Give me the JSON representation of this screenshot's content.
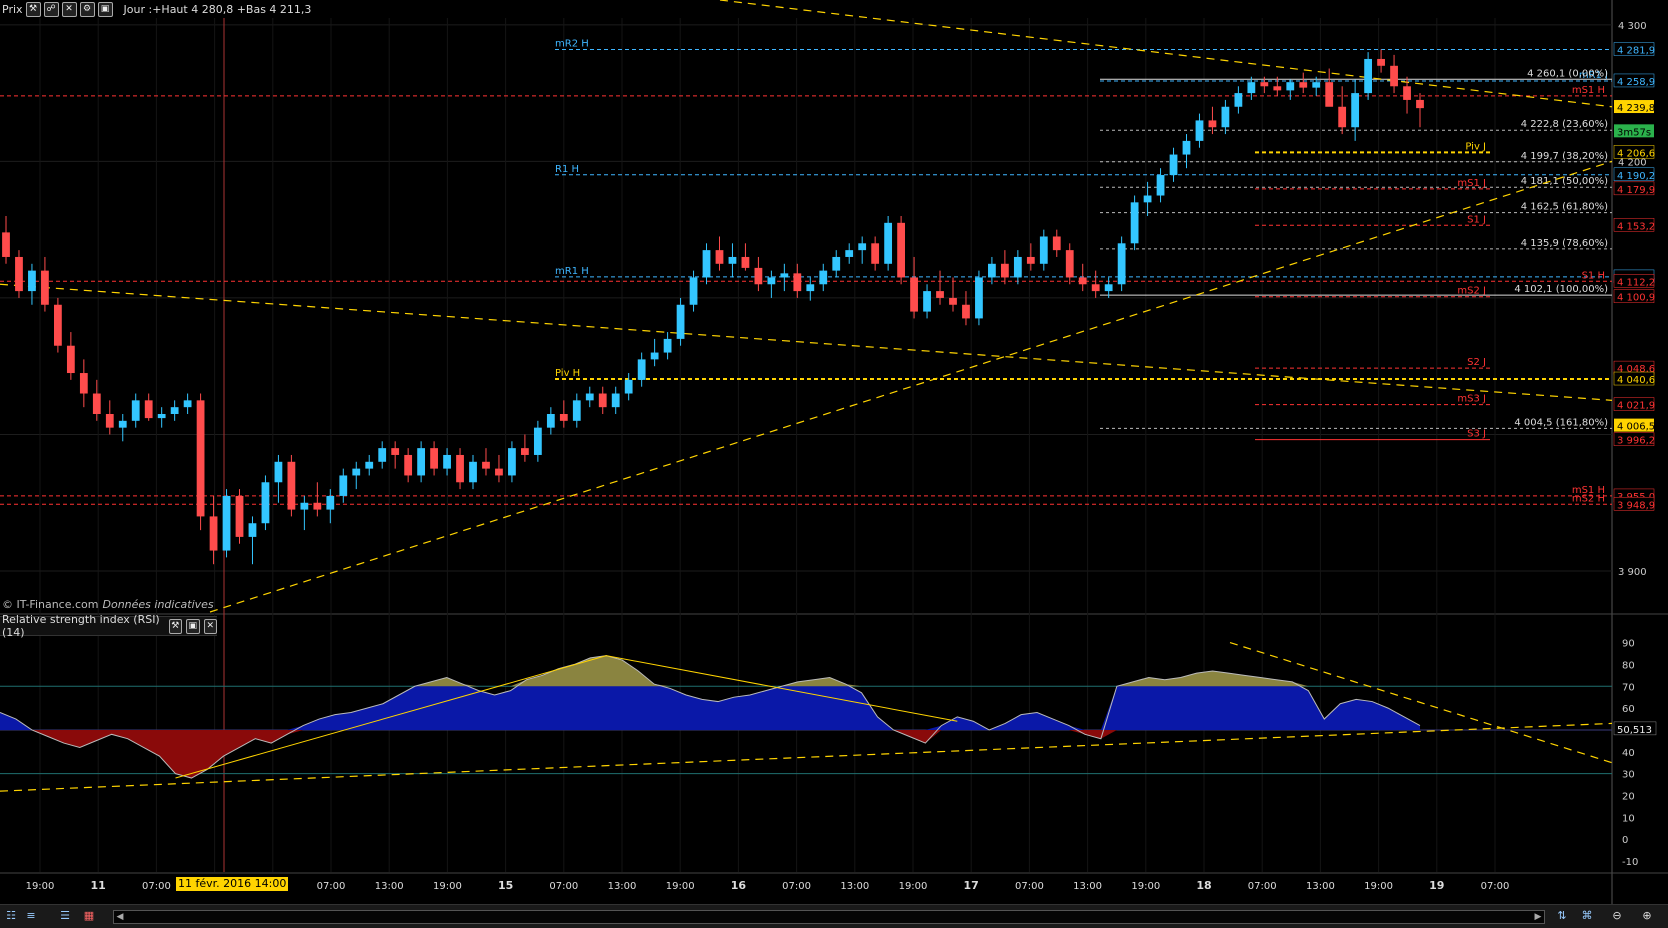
{
  "toolbar": {
    "label": "Prix",
    "info": "Jour :+Haut 4 280,8 +Bas 4 211,3",
    "icons": [
      "wrench-icon",
      "link-icon",
      "close-icon",
      "settings-icon",
      "window-icon"
    ]
  },
  "watermark": {
    "source": "© IT-Finance.com",
    "note": "Données indicatives"
  },
  "rsi_panel": {
    "title": "Relative strength index (RSI) (14)",
    "current_value": "50,513"
  },
  "price_axis": {
    "ticks": [
      "4 300",
      "4 200",
      "3 900"
    ],
    "tags": [
      {
        "text": "4 281,9",
        "bg": "#000",
        "fg": "#3fb6ff"
      },
      {
        "text": "4 258,9",
        "bg": "#000",
        "fg": "#3fb6ff"
      },
      {
        "text": "4 239,8",
        "bg": "#ffd400",
        "fg": "#000"
      },
      {
        "text": "3m57s",
        "bg": "#2bb24c",
        "fg": "#000"
      },
      {
        "text": "4 206,6",
        "bg": "#000",
        "fg": "#ffd400"
      },
      {
        "text": "4 190,2",
        "bg": "#000",
        "fg": "#3fb6ff"
      },
      {
        "text": "4 179,9",
        "bg": "#000",
        "fg": "#ff3333"
      },
      {
        "text": "4 153,2",
        "bg": "#000",
        "fg": "#ff3333"
      },
      {
        "text": "4 115,4",
        "bg": "#000",
        "fg": "#3fb6ff"
      },
      {
        "text": "4 112,2",
        "bg": "#000",
        "fg": "#ff3333"
      },
      {
        "text": "4 100,9",
        "bg": "#000",
        "fg": "#ff3333"
      },
      {
        "text": "4 048,6",
        "bg": "#000",
        "fg": "#ff3333"
      },
      {
        "text": "4 040,6",
        "bg": "#000",
        "fg": "#ffd400"
      },
      {
        "text": "4 021,9",
        "bg": "#000",
        "fg": "#ff3333"
      },
      {
        "text": "4 006,5",
        "bg": "#ffd400",
        "fg": "#000"
      },
      {
        "text": "3 996,2",
        "bg": "#000",
        "fg": "#ff3333"
      },
      {
        "text": "3 955,0",
        "bg": "#000",
        "fg": "#ff3333"
      },
      {
        "text": "3 948,9",
        "bg": "#000",
        "fg": "#ff3333"
      }
    ]
  },
  "rsi_axis": {
    "ticks": [
      "90",
      "80",
      "70",
      "60",
      "50",
      "40",
      "30",
      "20",
      "10",
      "0",
      "-10"
    ]
  },
  "levels": {
    "pivots": [
      "mR2 H",
      "mR1 J",
      "mS1 H",
      "R1 H",
      "mR1 H",
      "Piv H",
      "mS1 H",
      "Piv J",
      "mS1 J",
      "S1 J",
      "S1 H",
      "mS2 J",
      "S2 J",
      "mS3 J",
      "S3 J",
      "mS2 H"
    ],
    "fib": [
      "4 260,1 (0,00%)",
      "4 222,8 (23,60%)",
      "4 199,7 (38,20%)",
      "4 181,1 (50,00%)",
      "4 162,5 (61,80%)",
      "4 135,9 (78,60%)",
      "4 102,1 (100,00%)",
      "4 004,5 (161,80%)"
    ]
  },
  "time_axis": {
    "labels": [
      "19:00",
      "11",
      "07:00",
      "",
      "12",
      "07:00",
      "13:00",
      "19:00",
      "15",
      "07:00",
      "13:00",
      "19:00",
      "16",
      "07:00",
      "13:00",
      "19:00",
      "17",
      "07:00",
      "13:00",
      "19:00",
      "18",
      "07:00",
      "13:00",
      "19:00",
      "19",
      "07:00"
    ],
    "cursor_label": "11 févr. 2016 14:00"
  },
  "bottom_bar": {
    "icons": [
      "hierarchy-icon",
      "chart-type-icon",
      "list-icon",
      "template-icon",
      "scroll-left-icon",
      "scroll-right-icon",
      "sort-icon",
      "crosshair-icon",
      "zoom-out-icon",
      "zoom-in-icon"
    ]
  },
  "colors": {
    "up": "#33c6ff",
    "down": "#ff4c4c",
    "pivot_yellow": "#ffd400",
    "rsi_blue": "#0a18a8",
    "rsi_red": "#8a0a0a",
    "rsi_olive": "#8a8440"
  },
  "chart_data": {
    "type": "candlestick",
    "ylim": [
      3870,
      4305
    ],
    "rsi_ylim": [
      -15,
      93
    ],
    "candles": [
      [
        4148,
        4160,
        4125,
        4130
      ],
      [
        4130,
        4135,
        4100,
        4105
      ],
      [
        4105,
        4125,
        4095,
        4120
      ],
      [
        4120,
        4130,
        4090,
        4095
      ],
      [
        4095,
        4100,
        4060,
        4065
      ],
      [
        4065,
        4075,
        4040,
        4045
      ],
      [
        4045,
        4055,
        4020,
        4030
      ],
      [
        4030,
        4040,
        4010,
        4015
      ],
      [
        4015,
        4025,
        4000,
        4005
      ],
      [
        4005,
        4015,
        3995,
        4010
      ],
      [
        4010,
        4030,
        4005,
        4025
      ],
      [
        4025,
        4030,
        4010,
        4012
      ],
      [
        4012,
        4020,
        4005,
        4015
      ],
      [
        4015,
        4025,
        4010,
        4020
      ],
      [
        4020,
        4030,
        4015,
        4025
      ],
      [
        4025,
        4030,
        3930,
        3940
      ],
      [
        3940,
        3955,
        3905,
        3915
      ],
      [
        3915,
        3960,
        3910,
        3955
      ],
      [
        3955,
        3960,
        3920,
        3925
      ],
      [
        3925,
        3940,
        3905,
        3935
      ],
      [
        3935,
        3970,
        3930,
        3965
      ],
      [
        3965,
        3985,
        3950,
        3980
      ],
      [
        3980,
        3985,
        3940,
        3945
      ],
      [
        3945,
        3955,
        3930,
        3950
      ],
      [
        3950,
        3965,
        3940,
        3945
      ],
      [
        3945,
        3960,
        3935,
        3955
      ],
      [
        3955,
        3975,
        3950,
        3970
      ],
      [
        3970,
        3980,
        3960,
        3975
      ],
      [
        3975,
        3985,
        3970,
        3980
      ],
      [
        3980,
        3995,
        3975,
        3990
      ],
      [
        3990,
        3995,
        3975,
        3985
      ],
      [
        3985,
        3990,
        3965,
        3970
      ],
      [
        3970,
        3995,
        3965,
        3990
      ],
      [
        3990,
        3995,
        3970,
        3975
      ],
      [
        3975,
        3990,
        3970,
        3985
      ],
      [
        3985,
        3990,
        3960,
        3965
      ],
      [
        3965,
        3985,
        3960,
        3980
      ],
      [
        3980,
        3990,
        3970,
        3975
      ],
      [
        3975,
        3985,
        3965,
        3970
      ],
      [
        3970,
        3995,
        3965,
        3990
      ],
      [
        3990,
        4000,
        3980,
        3985
      ],
      [
        3985,
        4010,
        3980,
        4005
      ],
      [
        4005,
        4020,
        4000,
        4015
      ],
      [
        4015,
        4025,
        4005,
        4010
      ],
      [
        4010,
        4030,
        4005,
        4025
      ],
      [
        4025,
        4035,
        4020,
        4030
      ],
      [
        4030,
        4035,
        4015,
        4020
      ],
      [
        4020,
        4035,
        4015,
        4030
      ],
      [
        4030,
        4045,
        4025,
        4040
      ],
      [
        4040,
        4060,
        4035,
        4055
      ],
      [
        4055,
        4070,
        4050,
        4060
      ],
      [
        4060,
        4075,
        4055,
        4070
      ],
      [
        4070,
        4100,
        4065,
        4095
      ],
      [
        4095,
        4120,
        4090,
        4115
      ],
      [
        4115,
        4140,
        4110,
        4135
      ],
      [
        4135,
        4145,
        4120,
        4125
      ],
      [
        4125,
        4140,
        4115,
        4130
      ],
      [
        4130,
        4140,
        4120,
        4122
      ],
      [
        4122,
        4130,
        4105,
        4110
      ],
      [
        4110,
        4120,
        4100,
        4115
      ],
      [
        4115,
        4125,
        4105,
        4118
      ],
      [
        4118,
        4125,
        4100,
        4105
      ],
      [
        4105,
        4115,
        4098,
        4110
      ],
      [
        4110,
        4125,
        4105,
        4120
      ],
      [
        4120,
        4135,
        4115,
        4130
      ],
      [
        4130,
        4140,
        4125,
        4135
      ],
      [
        4135,
        4145,
        4125,
        4140
      ],
      [
        4140,
        4145,
        4120,
        4125
      ],
      [
        4125,
        4160,
        4120,
        4155
      ],
      [
        4155,
        4160,
        4110,
        4115
      ],
      [
        4115,
        4130,
        4085,
        4090
      ],
      [
        4090,
        4110,
        4085,
        4105
      ],
      [
        4105,
        4120,
        4095,
        4100
      ],
      [
        4100,
        4115,
        4090,
        4095
      ],
      [
        4095,
        4105,
        4080,
        4085
      ],
      [
        4085,
        4120,
        4080,
        4115
      ],
      [
        4115,
        4130,
        4110,
        4125
      ],
      [
        4125,
        4135,
        4110,
        4115
      ],
      [
        4115,
        4135,
        4110,
        4130
      ],
      [
        4130,
        4140,
        4120,
        4125
      ],
      [
        4125,
        4150,
        4120,
        4145
      ],
      [
        4145,
        4150,
        4130,
        4135
      ],
      [
        4135,
        4140,
        4110,
        4115
      ],
      [
        4115,
        4125,
        4105,
        4110
      ],
      [
        4110,
        4120,
        4100,
        4105
      ],
      [
        4105,
        4115,
        4100,
        4110
      ],
      [
        4110,
        4145,
        4105,
        4140
      ],
      [
        4140,
        4175,
        4135,
        4170
      ],
      [
        4170,
        4185,
        4160,
        4175
      ],
      [
        4175,
        4195,
        4170,
        4190
      ],
      [
        4190,
        4210,
        4185,
        4205
      ],
      [
        4205,
        4220,
        4195,
        4215
      ],
      [
        4215,
        4235,
        4210,
        4230
      ],
      [
        4230,
        4240,
        4220,
        4225
      ],
      [
        4225,
        4245,
        4220,
        4240
      ],
      [
        4240,
        4255,
        4235,
        4250
      ],
      [
        4250,
        4262,
        4245,
        4258
      ],
      [
        4258,
        4262,
        4250,
        4255
      ],
      [
        4255,
        4262,
        4248,
        4252
      ],
      [
        4252,
        4260,
        4245,
        4258
      ],
      [
        4258,
        4265,
        4250,
        4254
      ],
      [
        4254,
        4262,
        4248,
        4258
      ],
      [
        4258,
        4268,
        4245,
        4240
      ],
      [
        4240,
        4255,
        4220,
        4225
      ],
      [
        4225,
        4260,
        4215,
        4250
      ],
      [
        4250,
        4280,
        4245,
        4275
      ],
      [
        4275,
        4282,
        4265,
        4270
      ],
      [
        4270,
        4278,
        4250,
        4255
      ],
      [
        4255,
        4262,
        4235,
        4245
      ],
      [
        4245,
        4250,
        4225,
        4239
      ]
    ],
    "rsi_values": [
      58,
      55,
      50,
      47,
      44,
      42,
      45,
      48,
      46,
      42,
      38,
      30,
      28,
      32,
      38,
      42,
      46,
      44,
      48,
      52,
      55,
      57,
      58,
      60,
      62,
      66,
      70,
      72,
      74,
      71,
      68,
      66,
      68,
      73,
      75,
      78,
      80,
      83,
      84,
      82,
      77,
      71,
      69,
      66,
      64,
      63,
      65,
      66,
      68,
      70,
      72,
      73,
      74,
      71,
      67,
      56,
      50,
      47,
      44,
      52,
      56,
      54,
      50,
      53,
      57,
      58,
      55,
      52,
      48,
      46,
      70,
      72,
      74,
      73,
      74,
      76,
      77,
      76,
      75,
      74,
      73,
      72,
      68,
      55,
      62,
      64,
      63,
      60,
      56,
      52
    ],
    "rsi_lines": [
      70,
      50,
      30
    ]
  }
}
